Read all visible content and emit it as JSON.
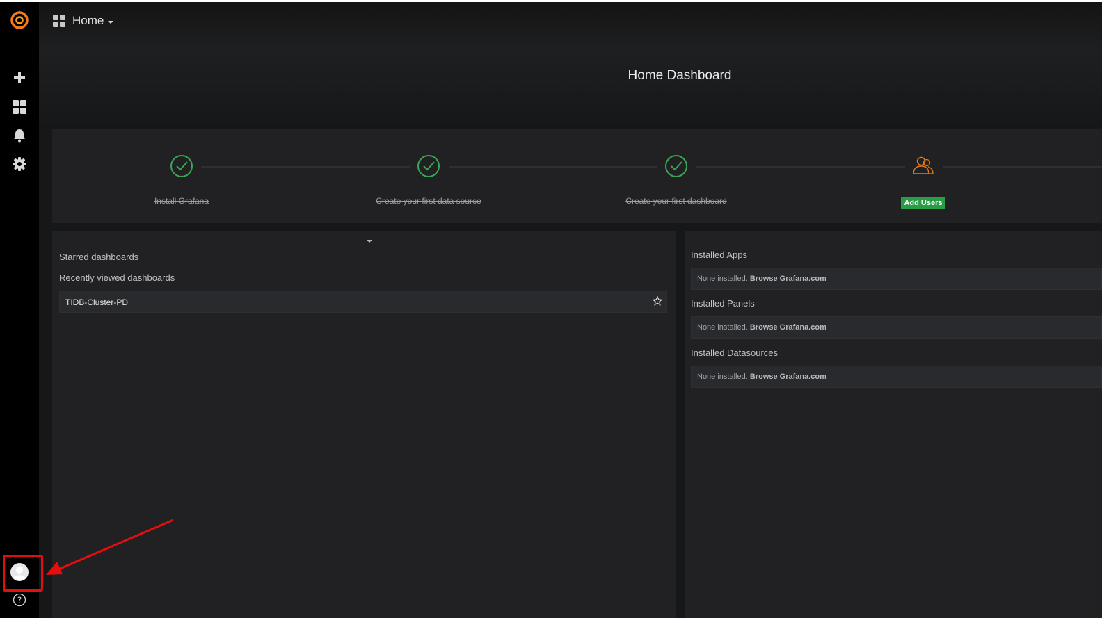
{
  "navbar": {
    "title": "Home"
  },
  "dashboard": {
    "title": "Home Dashboard"
  },
  "steps": [
    {
      "label": "Install Grafana",
      "done": true
    },
    {
      "label": "Create your first data source",
      "done": true
    },
    {
      "label": "Create your first dashboard",
      "done": true
    },
    {
      "label": "Add Users",
      "done": false
    }
  ],
  "left_panel": {
    "starred_heading": "Starred dashboards",
    "recent_heading": "Recently viewed dashboards",
    "recent_items": [
      "TIDB-Cluster-PD"
    ]
  },
  "right_panel": {
    "apps_heading": "Installed Apps",
    "panels_heading": "Installed Panels",
    "datasources_heading": "Installed Datasources",
    "none_text": "None installed.",
    "browse_text": "Browse Grafana.com"
  },
  "colors": {
    "accent": "#eb7b18",
    "success": "#299c46",
    "annotation": "#e60d0d"
  },
  "icons": {
    "sidebar": [
      "grafana-logo-icon",
      "plus-icon",
      "dashboards-icon",
      "bell-icon",
      "gear-icon",
      "user-avatar-icon",
      "help-icon"
    ]
  }
}
